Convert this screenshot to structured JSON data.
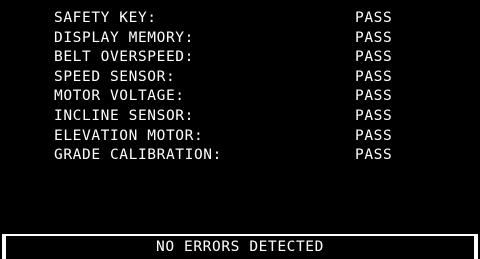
{
  "colors": {
    "background": "#000000",
    "text": "#ffffff",
    "status_border": "#ffffff"
  },
  "tests": [
    {
      "name": "SAFETY KEY:",
      "result": "PASS"
    },
    {
      "name": "DISPLAY MEMORY:",
      "result": "PASS"
    },
    {
      "name": "BELT OVERSPEED:",
      "result": "PASS"
    },
    {
      "name": "SPEED SENSOR:",
      "result": "PASS"
    },
    {
      "name": "MOTOR VOLTAGE:",
      "result": "PASS"
    },
    {
      "name": "INCLINE SENSOR:",
      "result": "PASS"
    },
    {
      "name": "ELEVATION MOTOR:",
      "result": "PASS"
    },
    {
      "name": "GRADE CALIBRATION:",
      "result": "PASS"
    }
  ],
  "status": {
    "message": "NO ERRORS DETECTED"
  }
}
